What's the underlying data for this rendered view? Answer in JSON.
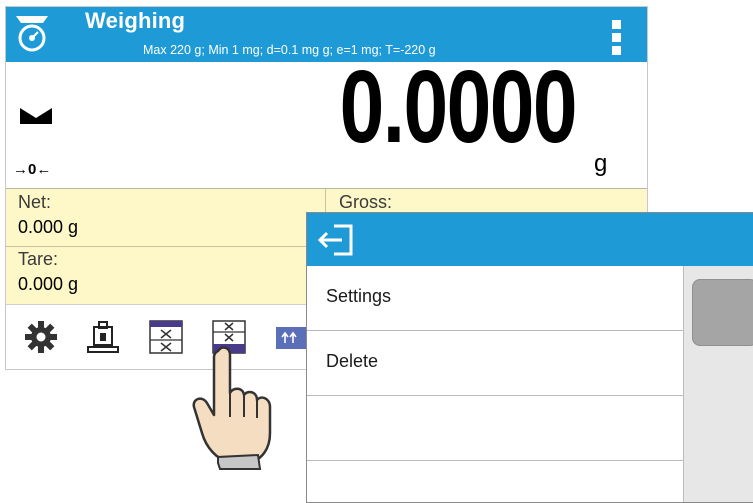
{
  "header": {
    "title": "Weighing",
    "subtitle": "Max 220 g; Min 1 mg; d=0.1 mg g; e=1 mg; T=-220 g",
    "accent_color": "#1e9bd7",
    "app_icon": "scale-icon",
    "menu_icon": "more-vertical-icon"
  },
  "reading": {
    "value": "0.0000",
    "unit": "g",
    "zero_indicator": "→0←",
    "stable_icon": "stable-indicator-icon"
  },
  "info": {
    "net_label": "Net:",
    "net_value": "0.000 g",
    "gross_label": "Gross:",
    "tare_label": "Tare:",
    "tare_value": "0.000 g",
    "panel_color": "#fef7c8"
  },
  "toolbar": {
    "buttons": [
      "gear-icon",
      "tare-weight-icon",
      "table-icon",
      "table-selected-icon",
      "arrows-icon"
    ]
  },
  "popup": {
    "back_icon": "exit-icon",
    "items": [
      {
        "label": "Settings"
      },
      {
        "label": "Delete"
      },
      {
        "label": ""
      },
      {
        "label": ""
      }
    ]
  }
}
